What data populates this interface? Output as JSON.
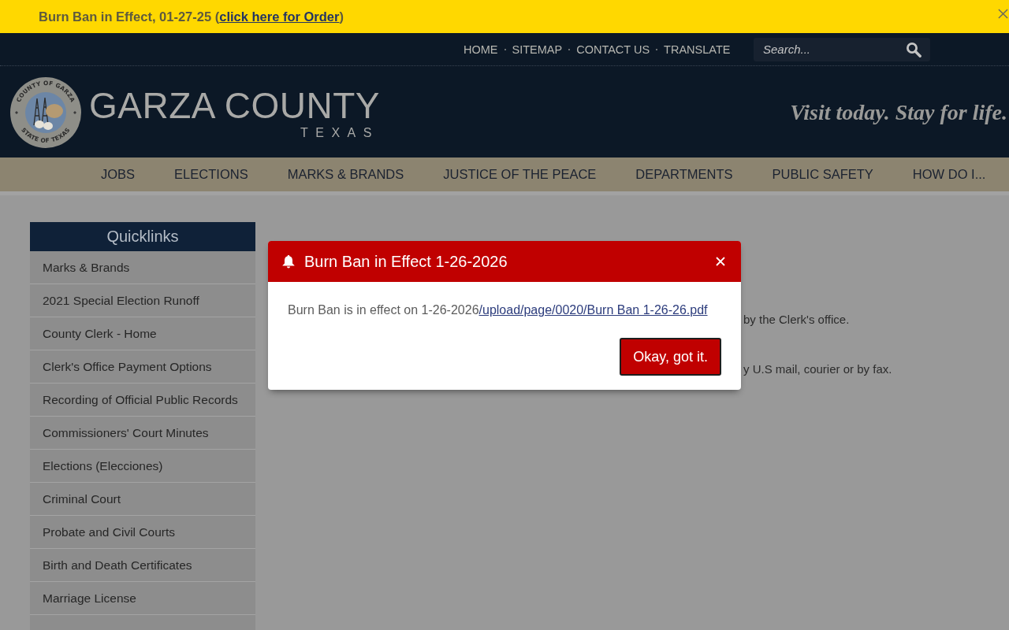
{
  "alert_banner": {
    "message": "Burn Ban in Effect, 01-27-25 (",
    "link": "click here for Order",
    "message_end": ")"
  },
  "header": {
    "utility_links": [
      "HOME",
      "SITEMAP",
      "CONTACT US",
      "TRANSLATE"
    ],
    "search": {
      "placeholder": "Search..."
    },
    "logo": {
      "seal_top": "COUNTY OF GARZA",
      "seal_bottom": "STATE OF TEXAS",
      "title": "GARZA COUNTY",
      "subtitle": "TEXAS"
    },
    "tagline": "Visit today. Stay for life."
  },
  "main_nav": [
    "JOBS",
    "ELECTIONS",
    "MARKS & BRANDS",
    "JUSTICE OF THE PEACE",
    "DEPARTMENTS",
    "PUBLIC SAFETY",
    "HOW DO I..."
  ],
  "sidebar": {
    "title": "Quicklinks",
    "items": [
      "Marks & Brands",
      "2021 Special Election Runoff",
      "County Clerk - Home",
      "Clerk's Office Payment Options",
      "Recording of Official Public Records",
      "Commissioners' Court Minutes",
      "Elections (Elecciones)",
      "Criminal Court",
      "Probate and Civil Courts",
      "Birth and Death Certificates",
      "Marriage License"
    ]
  },
  "content": {
    "text_fragments": [
      "by the Clerk's office.",
      "y U.S mail, courier or by fax."
    ]
  },
  "modal": {
    "title": "Burn Ban in Effect 1-26-2026",
    "message": "Burn Ban is in effect on 1-26-2026",
    "link": "/upload/page/0020/Burn Ban 1-26-26.pdf",
    "button": "Okay, got it."
  }
}
